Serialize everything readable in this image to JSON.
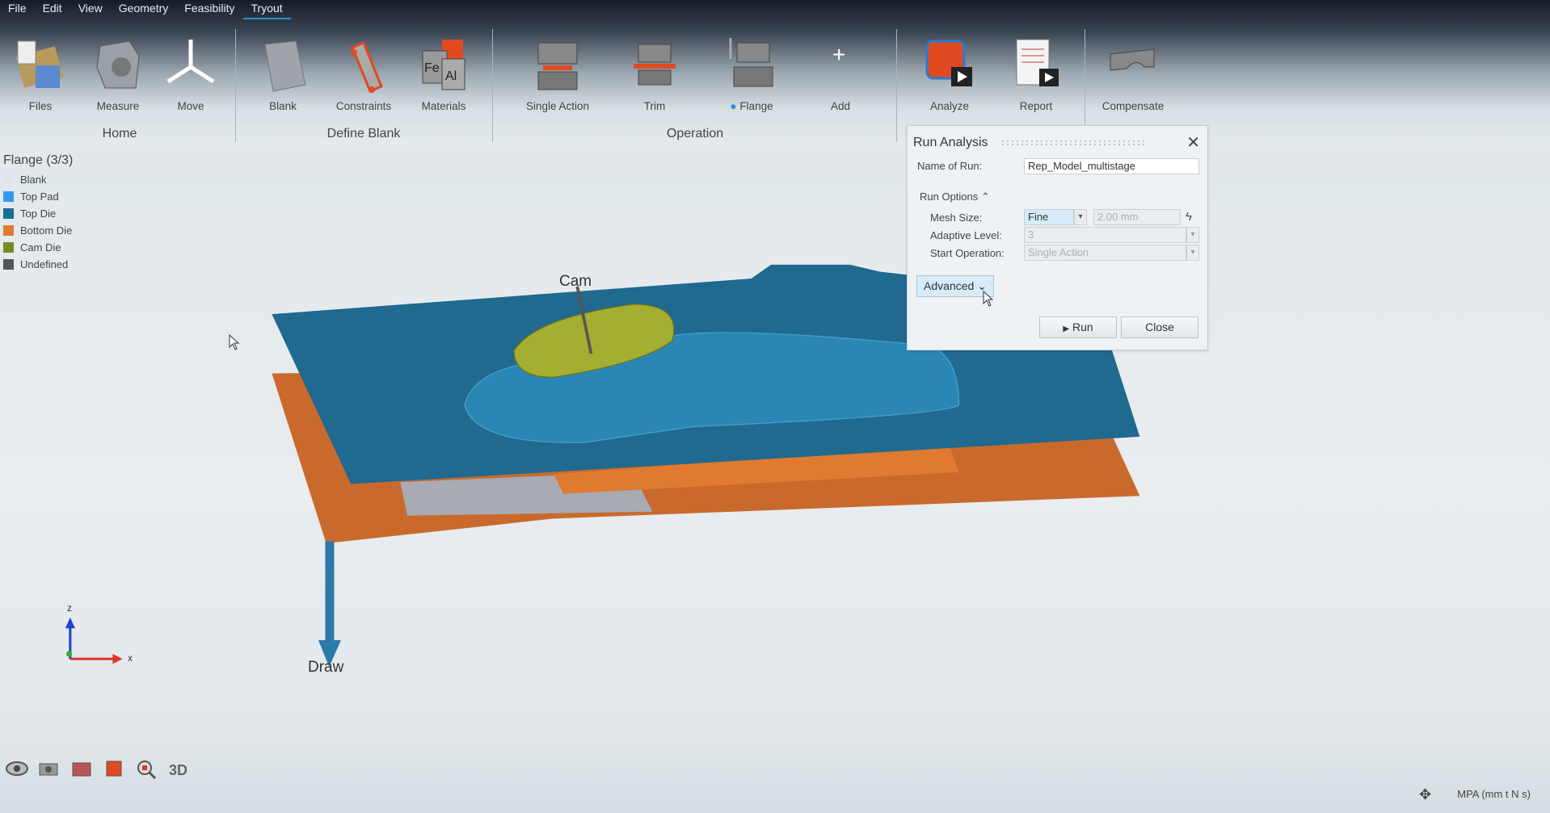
{
  "menu": [
    "File",
    "Edit",
    "View",
    "Geometry",
    "Feasibility",
    "Tryout"
  ],
  "active_menu": "Tryout",
  "toolbar": {
    "tools": [
      {
        "label": "Files",
        "icon": "files-icon"
      },
      {
        "label": "Measure",
        "icon": "measure-icon"
      },
      {
        "label": "Move",
        "icon": "move-icon"
      },
      {
        "label": "Blank",
        "icon": "blank-icon"
      },
      {
        "label": "Constraints",
        "icon": "constraints-icon"
      },
      {
        "label": "Materials",
        "icon": "materials-icon"
      },
      {
        "label": "Single Action",
        "icon": "single-action-icon"
      },
      {
        "label": "Trim",
        "icon": "trim-icon"
      },
      {
        "label": "Flange",
        "icon": "flange-icon",
        "checked": true
      },
      {
        "label": "Add",
        "icon": "plus-icon"
      },
      {
        "label": "Analyze",
        "icon": "analyze-icon"
      },
      {
        "label": "Report",
        "icon": "report-icon"
      },
      {
        "label": "Compensate",
        "icon": "compensate-icon"
      }
    ],
    "groups": [
      "Home",
      "Define Blank",
      "Operation"
    ]
  },
  "legend": {
    "title": "Flange (3/3)",
    "items": [
      {
        "label": "Blank",
        "color": "#e4e4f0"
      },
      {
        "label": "Top Pad",
        "color": "#3399ee"
      },
      {
        "label": "Top Die",
        "color": "#1a6e96"
      },
      {
        "label": "Bottom Die",
        "color": "#e07a30"
      },
      {
        "label": "Cam Die",
        "color": "#7a8a22"
      },
      {
        "label": "Undefined",
        "color": "#555555"
      }
    ]
  },
  "viewport": {
    "cam_label": "Cam",
    "draw_label": "Draw",
    "axis_x": "x",
    "axis_z": "z"
  },
  "dialog": {
    "title": "Run Analysis",
    "name_label": "Name of Run:",
    "name_value": "Rep_Model_multistage",
    "run_options": "Run Options",
    "mesh_label": "Mesh Size:",
    "mesh_value": "Fine",
    "mesh_size": "2.00 mm",
    "adaptive_label": "Adaptive Level:",
    "adaptive_value": "3",
    "start_label": "Start Operation:",
    "start_value": "Single Action",
    "advanced": "Advanced",
    "run": "Run",
    "close": "Close"
  },
  "status": {
    "units": "MPA (mm t N s)"
  }
}
